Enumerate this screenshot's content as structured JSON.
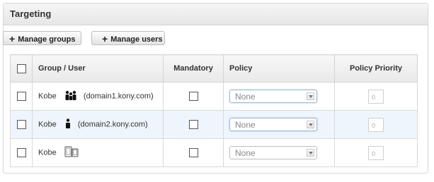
{
  "panel": {
    "title": "Targeting"
  },
  "toolbar": {
    "manage_groups": "Manage groups",
    "manage_users": "Manage users"
  },
  "table": {
    "headers": {
      "group_user": "Group / User",
      "mandatory": "Mandatory",
      "policy": "Policy",
      "policy_priority": "Policy Priority"
    },
    "rows": [
      {
        "name": "Kobe",
        "icon": "group-icon",
        "domain": "(domain1.kony.com)",
        "mandatory": false,
        "policy": "None",
        "priority": "0"
      },
      {
        "name": "Kobe",
        "icon": "user-icon",
        "domain": "(domain2.kony.com)",
        "mandatory": false,
        "policy": "None",
        "priority": "0"
      },
      {
        "name": "Kobe",
        "icon": "devices-icon",
        "domain": "",
        "mandatory": false,
        "policy": "None",
        "priority": "0"
      }
    ]
  },
  "colors": {
    "header_bg": "#e9e9e9",
    "alt_row_bg": "#eef5fc",
    "select_border_focus": "#9fb7d2"
  }
}
